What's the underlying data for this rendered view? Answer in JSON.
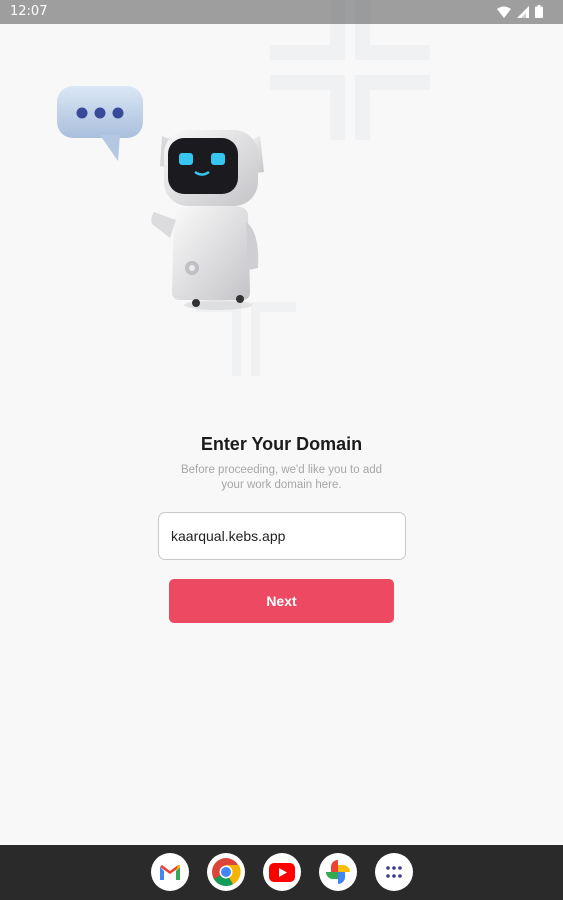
{
  "status_bar": {
    "time": "12:07",
    "icons": [
      "wifi-icon",
      "signal-icon",
      "battery-icon"
    ]
  },
  "illustration": {
    "bubble_icon": "chat-bubble-icon",
    "robot_icon": "robot-mascot"
  },
  "main": {
    "title": "Enter Your Domain",
    "subtitle": "Before proceeding, we'd like you to add your work domain here.",
    "domain_input": {
      "value": "kaarqual.kebs.app"
    },
    "next_label": "Next"
  },
  "dock": {
    "apps": [
      "gmail-icon",
      "chrome-icon",
      "youtube-icon",
      "photos-icon",
      "app-drawer-icon"
    ]
  },
  "colors": {
    "accent": "#ee4962",
    "background": "#f8f8f8",
    "status_bar": "#9e9e9e",
    "nav_bar": "#2a2a2a"
  }
}
